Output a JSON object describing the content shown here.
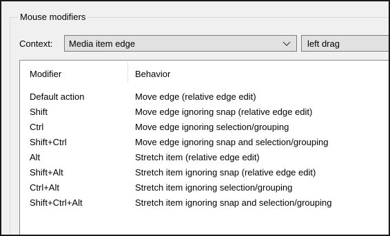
{
  "group": {
    "title": "Mouse modifiers"
  },
  "context": {
    "label": "Context:",
    "selected": "Media item edge",
    "action_selected": "left drag"
  },
  "table": {
    "headers": {
      "modifier": "Modifier",
      "behavior": "Behavior"
    },
    "rows": [
      {
        "modifier": "Default action",
        "behavior": "Move edge (relative edge edit)"
      },
      {
        "modifier": "Shift",
        "behavior": "Move edge ignoring snap (relative edge edit)"
      },
      {
        "modifier": "Ctrl",
        "behavior": "Move edge ignoring selection/grouping"
      },
      {
        "modifier": "Shift+Ctrl",
        "behavior": "Move edge ignoring snap and selection/grouping"
      },
      {
        "modifier": "Alt",
        "behavior": "Stretch item (relative edge edit)"
      },
      {
        "modifier": "Shift+Alt",
        "behavior": "Stretch item ignoring snap (relative edge edit)"
      },
      {
        "modifier": "Ctrl+Alt",
        "behavior": "Stretch item ignoring selection/grouping"
      },
      {
        "modifier": "Shift+Ctrl+Alt",
        "behavior": "Stretch item ignoring snap and selection/grouping"
      }
    ]
  },
  "icons": {
    "dropdown": "chevron-down-icon"
  },
  "colors": {
    "panel": "#f0f0f0",
    "list_background": "#ffffff",
    "combo_background": "#e1e1e1"
  }
}
